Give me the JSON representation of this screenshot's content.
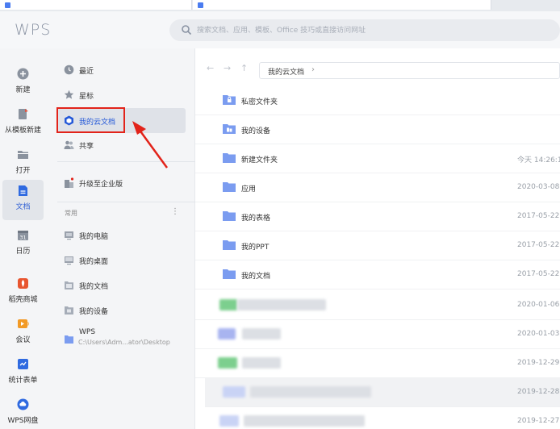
{
  "header": {
    "logo_text": "WPS",
    "search_placeholder": "搜索文档、应用、模板、Office 技巧或直接访问网址"
  },
  "left_sidebar": {
    "items": [
      {
        "label": "新建",
        "icon": "plus-circle-icon"
      },
      {
        "label": "从模板新建",
        "icon": "template-icon"
      },
      {
        "label": "打开",
        "icon": "folder-open-icon"
      },
      {
        "label": "文档",
        "icon": "document-icon",
        "active": true
      },
      {
        "label": "日历",
        "icon": "calendar-icon"
      },
      {
        "label": "稻壳商城",
        "icon": "docer-icon"
      },
      {
        "label": "会议",
        "icon": "meeting-icon"
      },
      {
        "label": "统计表单",
        "icon": "form-icon"
      },
      {
        "label": "WPS网盘",
        "icon": "cloud-drive-icon"
      }
    ]
  },
  "nav": {
    "items": [
      {
        "label": "最近",
        "icon": "clock-icon"
      },
      {
        "label": "星标",
        "icon": "star-icon"
      },
      {
        "label": "我的云文档",
        "icon": "cloud-doc-icon",
        "selected": true
      },
      {
        "label": "共享",
        "icon": "people-icon"
      }
    ],
    "upgrade_label": "升级至企业版",
    "common_section": {
      "title": "常用",
      "more": "⋮",
      "items": [
        {
          "label": "我的电脑",
          "icon": "computer-icon"
        },
        {
          "label": "我的桌面",
          "icon": "desktop-icon"
        },
        {
          "label": "我的文档",
          "icon": "documents-folder-icon"
        },
        {
          "label": "我的设备",
          "icon": "device-icon"
        },
        {
          "label": "WPS",
          "sub": "C:\\Users\\Adm...ator\\Desktop",
          "icon": "folder-icon"
        }
      ]
    }
  },
  "main": {
    "nav_buttons": {
      "back": "←",
      "forward": "→",
      "up": "↑"
    },
    "breadcrumb": {
      "label": "我的云文档",
      "chevron": "›"
    },
    "rows": [
      {
        "name": "私密文件夹",
        "date": "",
        "icon": "lock-folder-icon"
      },
      {
        "name": "我的设备",
        "date": "",
        "icon": "device-folder-icon"
      },
      {
        "name": "新建文件夹",
        "date": "今天 14:26:1",
        "icon": "folder-icon"
      },
      {
        "name": "应用",
        "date": "2020-03-08",
        "icon": "folder-icon"
      },
      {
        "name": "我的表格",
        "date": "2017-05-22",
        "icon": "folder-icon"
      },
      {
        "name": "我的PPT",
        "date": "2017-05-22",
        "icon": "folder-icon"
      },
      {
        "name": "我的文档",
        "date": "2017-05-22",
        "icon": "folder-icon"
      },
      {
        "name": "",
        "date": "2020-01-06",
        "icon": "spreadsheet-file-icon"
      },
      {
        "name": "",
        "date": "2020-01-03",
        "icon": "file-icon"
      },
      {
        "name": "",
        "date": "2019-12-29",
        "icon": "spreadsheet-file-icon"
      },
      {
        "name": "",
        "date": "2019-12-28",
        "icon": "file-icon"
      },
      {
        "name": "",
        "date": "2019-12-27",
        "icon": "file-icon"
      }
    ]
  },
  "colors": {
    "accent": "#2458d8",
    "highlight_box": "#e2231a",
    "folder": "#7b9cf0"
  }
}
